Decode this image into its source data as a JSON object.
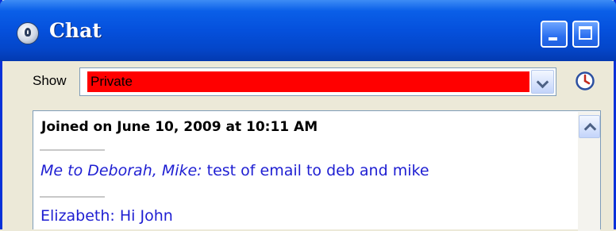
{
  "window": {
    "title": "Chat",
    "buttons": [
      "minimize",
      "maximize"
    ]
  },
  "filter": {
    "label": "Show",
    "selected": "Private",
    "highlight_color": "#ff0000"
  },
  "chat": {
    "joined_text": "Joined on June 10, 2009 at 10:11 AM",
    "messages": [
      {
        "sender": "Me to Deborah, Mike:",
        "text": " test of email to deb and mike",
        "sender_style": "italic"
      },
      {
        "sender": "Elizabeth:",
        "text": " Hi John",
        "sender_style": "normal"
      }
    ],
    "message_color": "#1e1ed2"
  },
  "icons": {
    "app": "chat-app-icon",
    "history": "clock-icon",
    "dropdown": "chevron-down-icon",
    "scroll_up": "chevron-up-icon"
  },
  "theme": {
    "titlebar": "#0550dc",
    "frame": "#ece9d8"
  }
}
